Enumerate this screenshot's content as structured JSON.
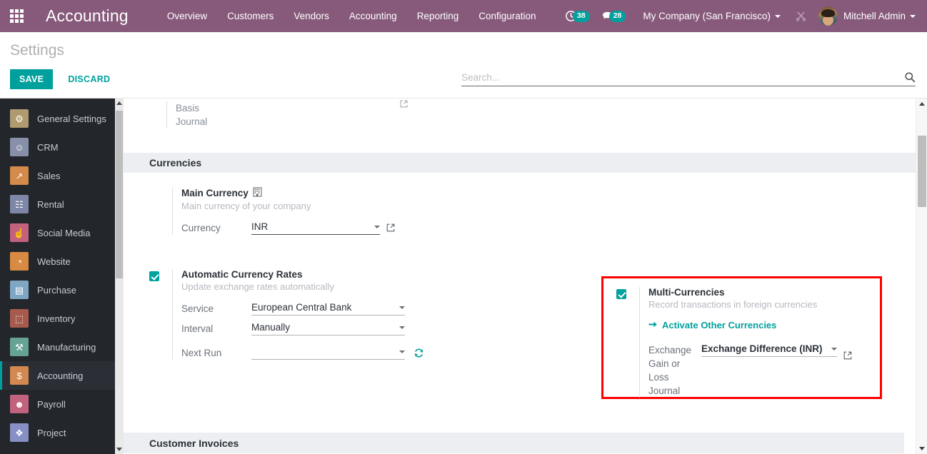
{
  "navbar": {
    "apps_icon": "apps-grid-icon",
    "brand": "Accounting",
    "menu": [
      {
        "label": "Overview"
      },
      {
        "label": "Customers"
      },
      {
        "label": "Vendors"
      },
      {
        "label": "Accounting"
      },
      {
        "label": "Reporting"
      },
      {
        "label": "Configuration"
      }
    ],
    "activity_count": "38",
    "messages_count": "28",
    "company": "My Company (San Francisco)",
    "user": "Mitchell Admin",
    "accent": "#875A7B",
    "badge_color": "#00A09D"
  },
  "control_panel": {
    "title": "Settings",
    "save_label": "SAVE",
    "discard_label": "DISCARD",
    "search_placeholder": "Search...",
    "search_value": ""
  },
  "sidebar": {
    "items": [
      {
        "label": "General Settings",
        "icon": "gear-icon",
        "color": "#b09a70",
        "glyph": "⚙",
        "active": false
      },
      {
        "label": "CRM",
        "icon": "handshake-icon",
        "color": "#8790a8",
        "glyph": "☺",
        "active": false
      },
      {
        "label": "Sales",
        "icon": "chart-line-icon",
        "color": "#d38a4a",
        "glyph": "↗",
        "active": false
      },
      {
        "label": "Rental",
        "icon": "document-icon",
        "color": "#7f87a6",
        "glyph": "☷",
        "active": false
      },
      {
        "label": "Social Media",
        "icon": "thumbs-up-icon",
        "color": "#c2627f",
        "glyph": "☝",
        "active": false
      },
      {
        "label": "Website",
        "icon": "globe-icon",
        "color": "#d98a42",
        "glyph": "◔",
        "active": false
      },
      {
        "label": "Purchase",
        "icon": "credit-card-icon",
        "color": "#7fa7c4",
        "glyph": "▤",
        "active": false
      },
      {
        "label": "Inventory",
        "icon": "box-icon",
        "color": "#a75b4e",
        "glyph": "⬚",
        "active": false
      },
      {
        "label": "Manufacturing",
        "icon": "wrench-icon",
        "color": "#66a396",
        "glyph": "⚒",
        "active": false
      },
      {
        "label": "Accounting",
        "icon": "invoice-icon",
        "color": "#d2884f",
        "glyph": "$",
        "active": true
      },
      {
        "label": "Payroll",
        "icon": "employee-icon",
        "color": "#c2627f",
        "glyph": "☻",
        "active": false
      },
      {
        "label": "Project",
        "icon": "puzzle-icon",
        "color": "#8790c4",
        "glyph": "❖",
        "active": false
      }
    ]
  },
  "content": {
    "stub": {
      "line1": "Basis",
      "line2": "Journal"
    },
    "currencies_section": "Currencies",
    "main_currency": {
      "title": "Main Currency",
      "company_icon": "building-icon",
      "description": "Main currency of your company",
      "field_label": "Currency",
      "field_value": "INR",
      "external_link_icon": "external-link-icon"
    },
    "multi_currencies": {
      "checked": true,
      "title": "Multi-Currencies",
      "description": "Record transactions in foreign currencies",
      "link_label": "Activate Other Currencies",
      "link_icon": "arrow-right-icon",
      "field_label": "Exchange Gain or Loss Journal",
      "field_label_lines": [
        "Exchange",
        "Gain or Loss",
        "Journal"
      ],
      "field_value": "Exchange Difference (INR)",
      "external_link_icon": "external-link-icon",
      "highlight_color": "#ff0000"
    },
    "automatic_currency_rates": {
      "checked": true,
      "title": "Automatic Currency Rates",
      "description": "Update exchange rates automatically",
      "fields": [
        {
          "label": "Service",
          "value": "European Central Bank"
        },
        {
          "label": "Interval",
          "value": "Manually"
        },
        {
          "label": "Next Run",
          "value": ""
        }
      ],
      "refresh_icon": "refresh-icon"
    },
    "customer_invoices_section": "Customer Invoices"
  }
}
